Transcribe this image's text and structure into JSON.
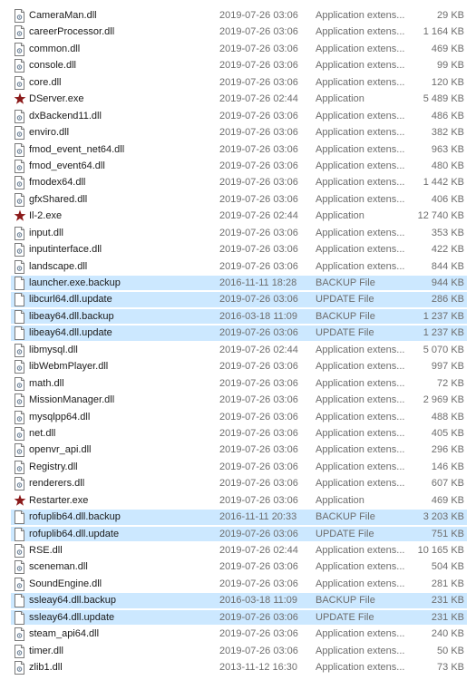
{
  "files": [
    {
      "name": "CameraMan.dll",
      "date": "2019-07-26 03:06",
      "type": "Application extens...",
      "size": "29 KB",
      "icon": "dll-file-icon",
      "selected": false
    },
    {
      "name": "careerProcessor.dll",
      "date": "2019-07-26 03:06",
      "type": "Application extens...",
      "size": "1 164 KB",
      "icon": "dll-file-icon",
      "selected": false
    },
    {
      "name": "common.dll",
      "date": "2019-07-26 03:06",
      "type": "Application extens...",
      "size": "469 KB",
      "icon": "dll-file-icon",
      "selected": false
    },
    {
      "name": "console.dll",
      "date": "2019-07-26 03:06",
      "type": "Application extens...",
      "size": "99 KB",
      "icon": "dll-file-icon",
      "selected": false
    },
    {
      "name": "core.dll",
      "date": "2019-07-26 03:06",
      "type": "Application extens...",
      "size": "120 KB",
      "icon": "dll-file-icon",
      "selected": false
    },
    {
      "name": "DServer.exe",
      "date": "2019-07-26 02:44",
      "type": "Application",
      "size": "5 489 KB",
      "icon": "red-star-exe-icon",
      "selected": false
    },
    {
      "name": "dxBackend11.dll",
      "date": "2019-07-26 03:06",
      "type": "Application extens...",
      "size": "486 KB",
      "icon": "dll-file-icon",
      "selected": false
    },
    {
      "name": "enviro.dll",
      "date": "2019-07-26 03:06",
      "type": "Application extens...",
      "size": "382 KB",
      "icon": "dll-file-icon",
      "selected": false
    },
    {
      "name": "fmod_event_net64.dll",
      "date": "2019-07-26 03:06",
      "type": "Application extens...",
      "size": "963 KB",
      "icon": "dll-file-icon",
      "selected": false
    },
    {
      "name": "fmod_event64.dll",
      "date": "2019-07-26 03:06",
      "type": "Application extens...",
      "size": "480 KB",
      "icon": "dll-file-icon",
      "selected": false
    },
    {
      "name": "fmodex64.dll",
      "date": "2019-07-26 03:06",
      "type": "Application extens...",
      "size": "1 442 KB",
      "icon": "dll-file-icon",
      "selected": false
    },
    {
      "name": "gfxShared.dll",
      "date": "2019-07-26 03:06",
      "type": "Application extens...",
      "size": "406 KB",
      "icon": "dll-file-icon",
      "selected": false
    },
    {
      "name": "Il-2.exe",
      "date": "2019-07-26 02:44",
      "type": "Application",
      "size": "12 740 KB",
      "icon": "red-star-exe-icon",
      "selected": false
    },
    {
      "name": "input.dll",
      "date": "2019-07-26 03:06",
      "type": "Application extens...",
      "size": "353 KB",
      "icon": "dll-file-icon",
      "selected": false
    },
    {
      "name": "inputinterface.dll",
      "date": "2019-07-26 03:06",
      "type": "Application extens...",
      "size": "422 KB",
      "icon": "dll-file-icon",
      "selected": false
    },
    {
      "name": "landscape.dll",
      "date": "2019-07-26 03:06",
      "type": "Application extens...",
      "size": "844 KB",
      "icon": "dll-file-icon",
      "selected": false
    },
    {
      "name": "launcher.exe.backup",
      "date": "2016-11-11 18:28",
      "type": "BACKUP File",
      "size": "944 KB",
      "icon": "blank-file-icon",
      "selected": true
    },
    {
      "name": "libcurl64.dll.update",
      "date": "2019-07-26 03:06",
      "type": "UPDATE File",
      "size": "286 KB",
      "icon": "blank-file-icon",
      "selected": true
    },
    {
      "name": "libeay64.dll.backup",
      "date": "2016-03-18 11:09",
      "type": "BACKUP File",
      "size": "1 237 KB",
      "icon": "blank-file-icon",
      "selected": true
    },
    {
      "name": "libeay64.dll.update",
      "date": "2019-07-26 03:06",
      "type": "UPDATE File",
      "size": "1 237 KB",
      "icon": "blank-file-icon",
      "selected": true
    },
    {
      "name": "libmysql.dll",
      "date": "2019-07-26 02:44",
      "type": "Application extens...",
      "size": "5 070 KB",
      "icon": "dll-file-icon",
      "selected": false
    },
    {
      "name": "libWebmPlayer.dll",
      "date": "2019-07-26 03:06",
      "type": "Application extens...",
      "size": "997 KB",
      "icon": "dll-file-icon",
      "selected": false
    },
    {
      "name": "math.dll",
      "date": "2019-07-26 03:06",
      "type": "Application extens...",
      "size": "72 KB",
      "icon": "dll-file-icon",
      "selected": false
    },
    {
      "name": "MissionManager.dll",
      "date": "2019-07-26 03:06",
      "type": "Application extens...",
      "size": "2 969 KB",
      "icon": "dll-file-icon",
      "selected": false
    },
    {
      "name": "mysqlpp64.dll",
      "date": "2019-07-26 03:06",
      "type": "Application extens...",
      "size": "488 KB",
      "icon": "dll-file-icon",
      "selected": false
    },
    {
      "name": "net.dll",
      "date": "2019-07-26 03:06",
      "type": "Application extens...",
      "size": "405 KB",
      "icon": "dll-file-icon",
      "selected": false
    },
    {
      "name": "openvr_api.dll",
      "date": "2019-07-26 03:06",
      "type": "Application extens...",
      "size": "296 KB",
      "icon": "dll-file-icon",
      "selected": false
    },
    {
      "name": "Registry.dll",
      "date": "2019-07-26 03:06",
      "type": "Application extens...",
      "size": "146 KB",
      "icon": "dll-file-icon",
      "selected": false
    },
    {
      "name": "renderers.dll",
      "date": "2019-07-26 03:06",
      "type": "Application extens...",
      "size": "607 KB",
      "icon": "dll-file-icon",
      "selected": false
    },
    {
      "name": "Restarter.exe",
      "date": "2019-07-26 03:06",
      "type": "Application",
      "size": "469 KB",
      "icon": "red-star-exe-icon",
      "selected": false
    },
    {
      "name": "rofuplib64.dll.backup",
      "date": "2016-11-11 20:33",
      "type": "BACKUP File",
      "size": "3 203 KB",
      "icon": "blank-file-icon",
      "selected": true
    },
    {
      "name": "rofuplib64.dll.update",
      "date": "2019-07-26 03:06",
      "type": "UPDATE File",
      "size": "751 KB",
      "icon": "blank-file-icon",
      "selected": true
    },
    {
      "name": "RSE.dll",
      "date": "2019-07-26 02:44",
      "type": "Application extens...",
      "size": "10 165 KB",
      "icon": "dll-file-icon",
      "selected": false
    },
    {
      "name": "sceneman.dll",
      "date": "2019-07-26 03:06",
      "type": "Application extens...",
      "size": "504 KB",
      "icon": "dll-file-icon",
      "selected": false
    },
    {
      "name": "SoundEngine.dll",
      "date": "2019-07-26 03:06",
      "type": "Application extens...",
      "size": "281 KB",
      "icon": "dll-file-icon",
      "selected": false
    },
    {
      "name": "ssleay64.dll.backup",
      "date": "2016-03-18 11:09",
      "type": "BACKUP File",
      "size": "231 KB",
      "icon": "blank-file-icon",
      "selected": true
    },
    {
      "name": "ssleay64.dll.update",
      "date": "2019-07-26 03:06",
      "type": "UPDATE File",
      "size": "231 KB",
      "icon": "blank-file-icon",
      "selected": true
    },
    {
      "name": "steam_api64.dll",
      "date": "2019-07-26 03:06",
      "type": "Application extens...",
      "size": "240 KB",
      "icon": "dll-file-icon",
      "selected": false
    },
    {
      "name": "timer.dll",
      "date": "2019-07-26 03:06",
      "type": "Application extens...",
      "size": "50 KB",
      "icon": "dll-file-icon",
      "selected": false
    },
    {
      "name": "zlib1.dll",
      "date": "2013-11-12 16:30",
      "type": "Application extens...",
      "size": "73 KB",
      "icon": "dll-file-icon",
      "selected": false
    }
  ],
  "colors": {
    "selection": "#cce8ff",
    "star": "#8b1a1a",
    "secondary_text": "#6d6d6d"
  }
}
